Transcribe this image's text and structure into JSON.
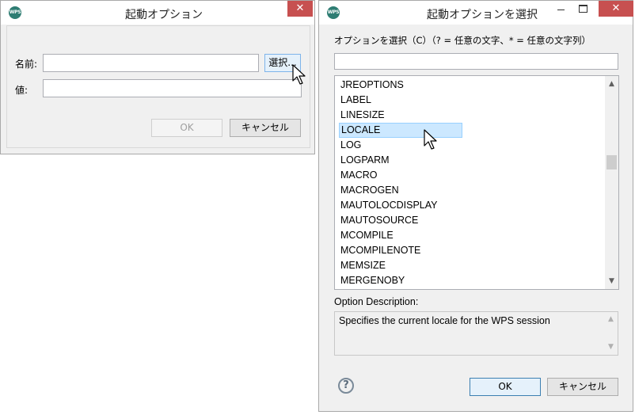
{
  "left_dialog": {
    "title": "起動オプション",
    "app_icon": "WPS",
    "close": "✕",
    "name_label": "名前:",
    "name_value": "",
    "select_button": "選択...",
    "value_label": "値:",
    "value_value": "",
    "ok": "OK",
    "cancel": "キャンセル"
  },
  "right_dialog": {
    "title": "起動オプションを選択",
    "app_icon": "WPS",
    "close": "✕",
    "filter_label": "オプションを選択（C）（? = 任意の文字、* = 任意の文字列）",
    "filter_value": "",
    "options": [
      "JREOPTIONS",
      "LABEL",
      "LINESIZE",
      "LOCALE",
      "LOG",
      "LOGPARM",
      "MACRO",
      "MACROGEN",
      "MAUTOLOCDISPLAY",
      "MAUTOSOURCE",
      "MCOMPILE",
      "MCOMPILENOTE",
      "MEMSIZE",
      "MERGENOBY"
    ],
    "selected": "LOCALE",
    "description_label": "Option Description:",
    "description": "Specifies the current locale for the WPS session",
    "help": "?",
    "ok": "OK",
    "cancel": "キャンセル"
  },
  "icons": {
    "cursor": "arrow-cursor-icon",
    "help": "help-icon",
    "scroll_up": "chevron-up-icon",
    "scroll_down": "chevron-down-icon"
  },
  "colors": {
    "close_button": "#c75050",
    "selection": "#cce8ff",
    "dialog_bg": "#f0f0f0"
  }
}
